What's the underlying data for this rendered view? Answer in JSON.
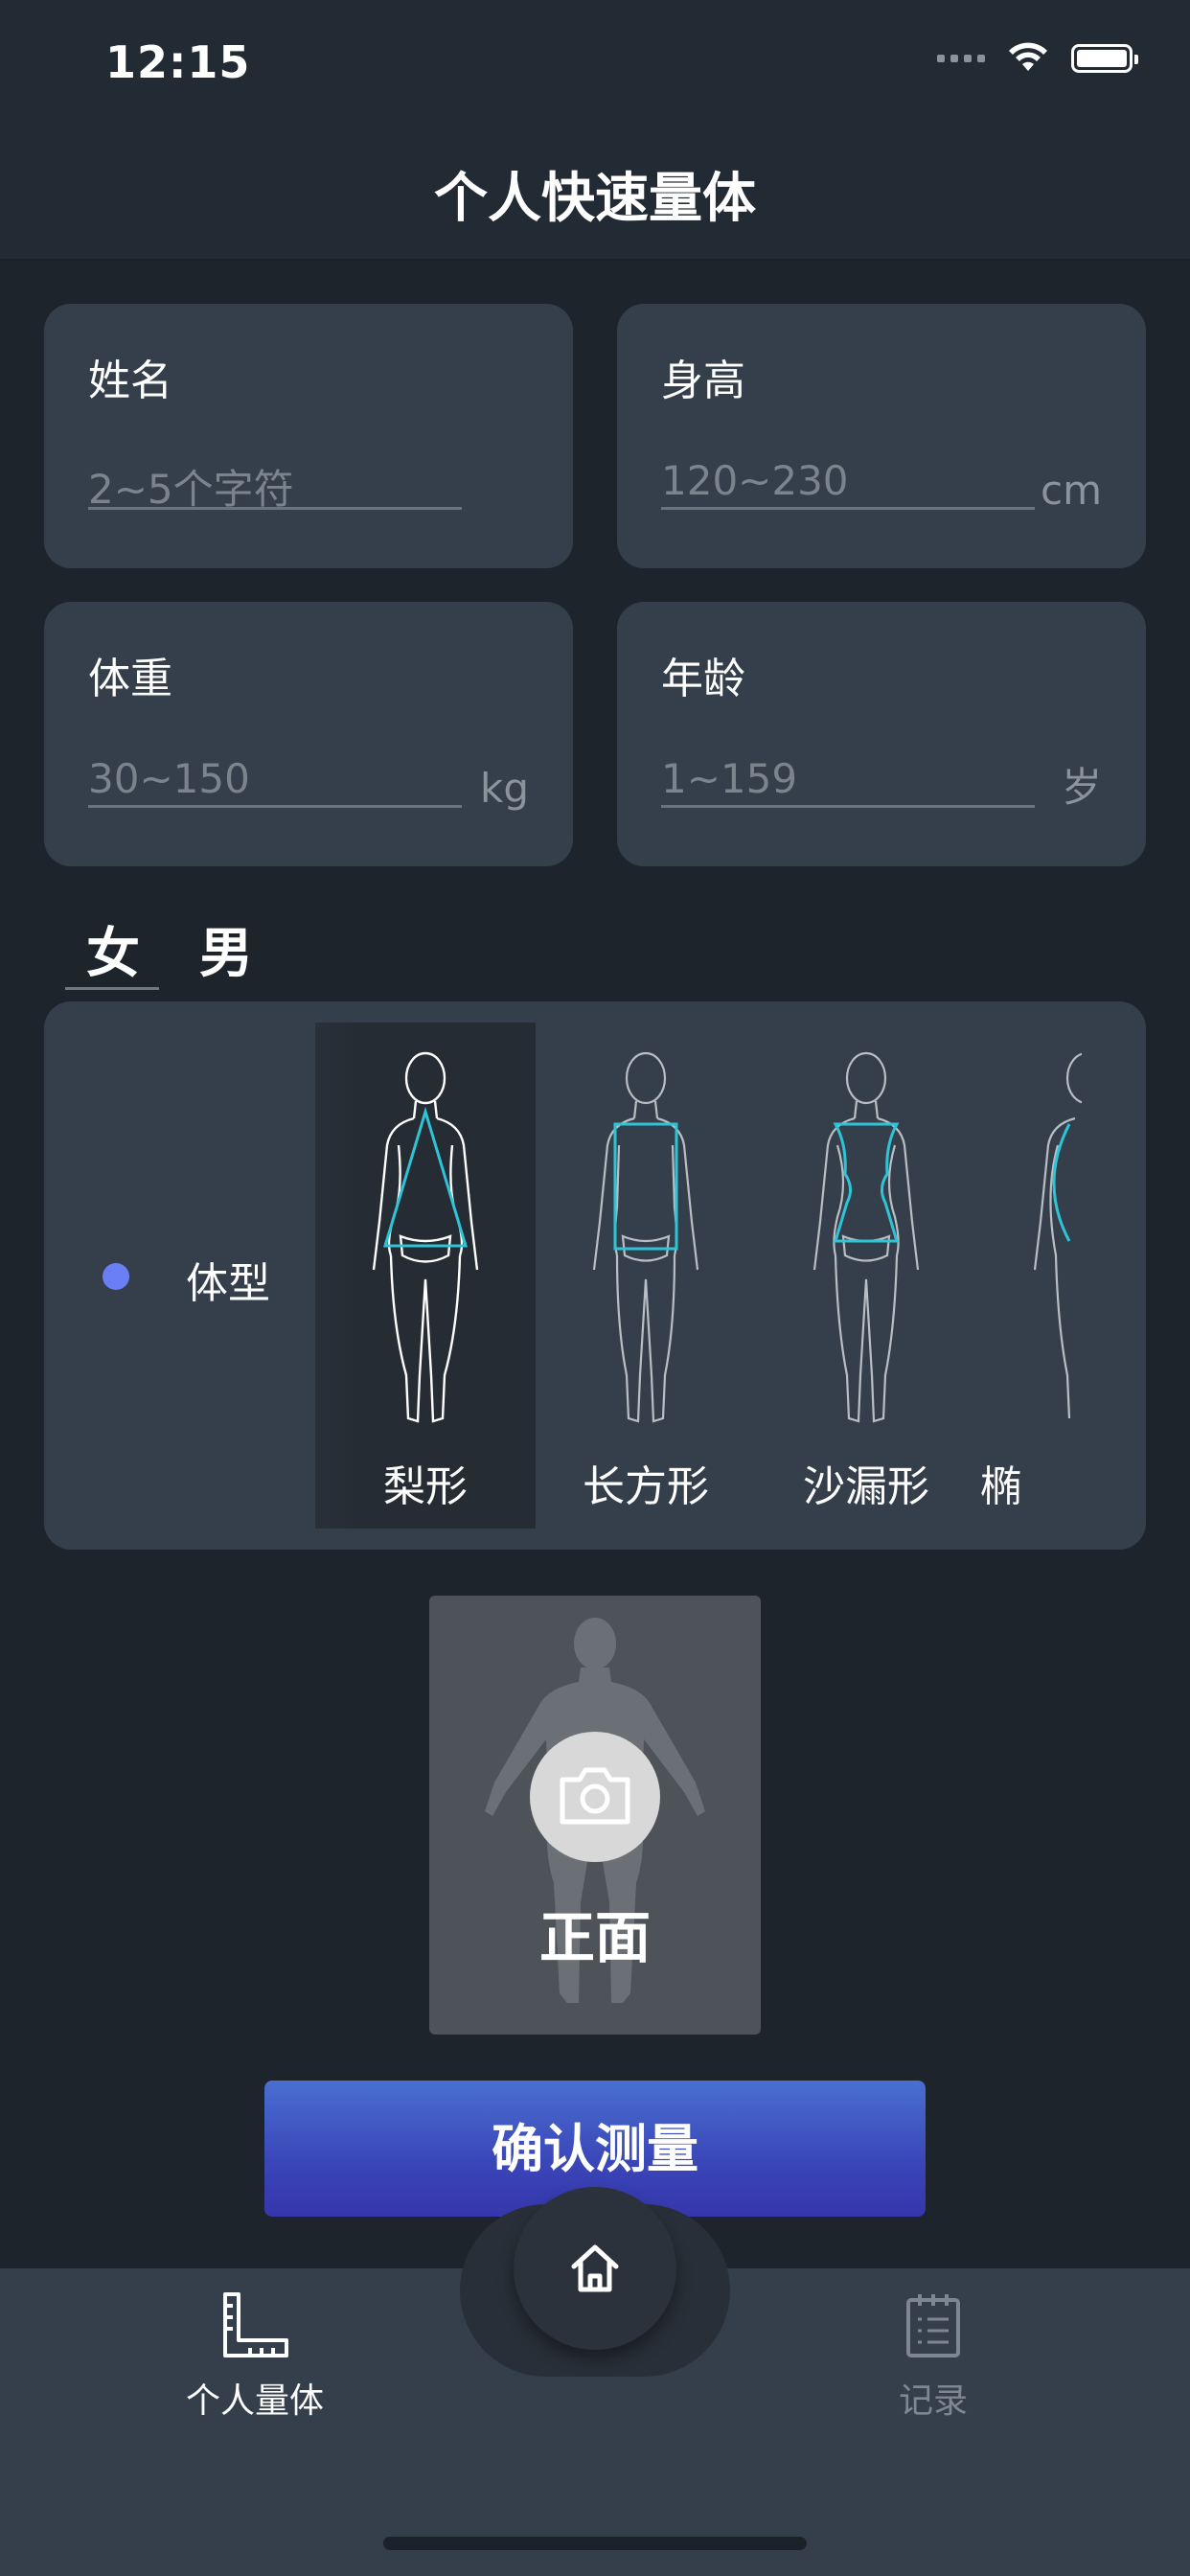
{
  "status_bar": {
    "time": "12:15"
  },
  "header": {
    "title": "个人快速量体"
  },
  "fields": {
    "name": {
      "label": "姓名",
      "placeholder": "2~5个字符",
      "unit": ""
    },
    "height": {
      "label": "身高",
      "placeholder": "120~230",
      "unit": "cm"
    },
    "weight": {
      "label": "体重",
      "placeholder": "30~150",
      "unit": "kg"
    },
    "age": {
      "label": "年龄",
      "placeholder": "1~159",
      "unit": "岁"
    }
  },
  "gender": {
    "female": "女",
    "male": "男",
    "selected": "女"
  },
  "body_shape": {
    "label": "体型",
    "options": [
      "梨形",
      "长方形",
      "沙漏形",
      "椭"
    ],
    "selected": "梨形",
    "accent_color": "#2ec4d6"
  },
  "photo": {
    "label": "正面"
  },
  "confirm_button": {
    "label": "确认测量"
  },
  "tabbar": {
    "tabs": [
      {
        "label": "个人量体",
        "icon": "ruler-icon",
        "active": true
      },
      {
        "label": "记录",
        "icon": "clipboard-icon",
        "active": false
      }
    ],
    "center_icon": "home-icon"
  },
  "colors": {
    "background": "#1d242c",
    "card": "#353f4b",
    "accent_dot": "#6a7ff5",
    "button": "#3a46b8"
  }
}
